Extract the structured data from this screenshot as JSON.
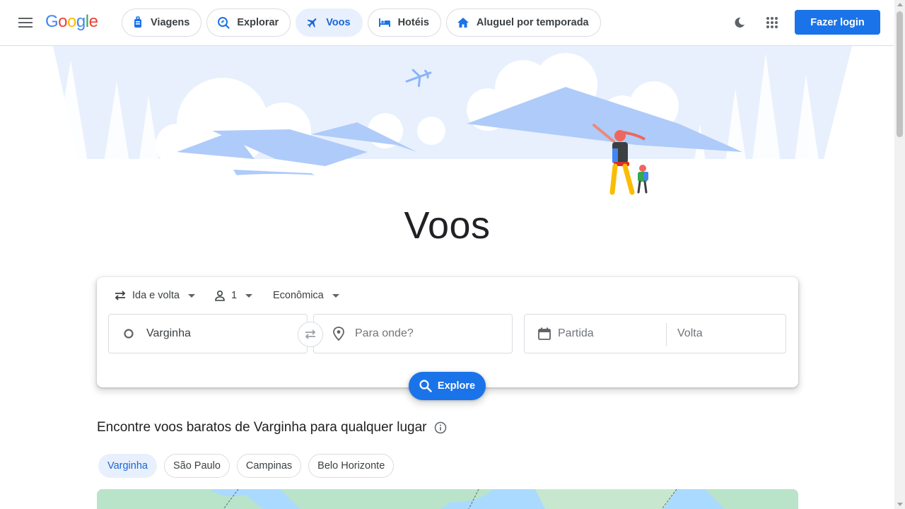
{
  "header": {
    "logo_letters": [
      "G",
      "o",
      "o",
      "g",
      "l",
      "e"
    ],
    "logo_colors": [
      "#4285f4",
      "#ea4335",
      "#fbbc05",
      "#4285f4",
      "#34a853",
      "#ea4335"
    ],
    "nav": [
      {
        "label": "Viagens",
        "icon": "travel-bag-icon",
        "active": false
      },
      {
        "label": "Explorar",
        "icon": "explore-icon",
        "active": false
      },
      {
        "label": "Voos",
        "icon": "airplane-icon",
        "active": true
      },
      {
        "label": "Hotéis",
        "icon": "bed-icon",
        "active": false
      },
      {
        "label": "Aluguel por temporada",
        "icon": "house-icon",
        "active": false
      }
    ],
    "login_label": "Fazer login",
    "accent": "#1a73e8"
  },
  "hero": {
    "title": "Voos"
  },
  "search": {
    "trip_type": "Ida e volta",
    "passengers": "1",
    "cabin_class": "Econômica",
    "origin": "Varginha",
    "destination_placeholder": "Para onde?",
    "departure_placeholder": "Partida",
    "return_placeholder": "Volta",
    "explore_label": "Explore"
  },
  "section": {
    "title": "Encontre voos baratos de Varginha para qualquer lugar",
    "pills": [
      {
        "label": "Varginha",
        "active": true
      },
      {
        "label": "São Paulo",
        "active": false
      },
      {
        "label": "Campinas",
        "active": false
      },
      {
        "label": "Belo Horizonte",
        "active": false
      }
    ]
  }
}
